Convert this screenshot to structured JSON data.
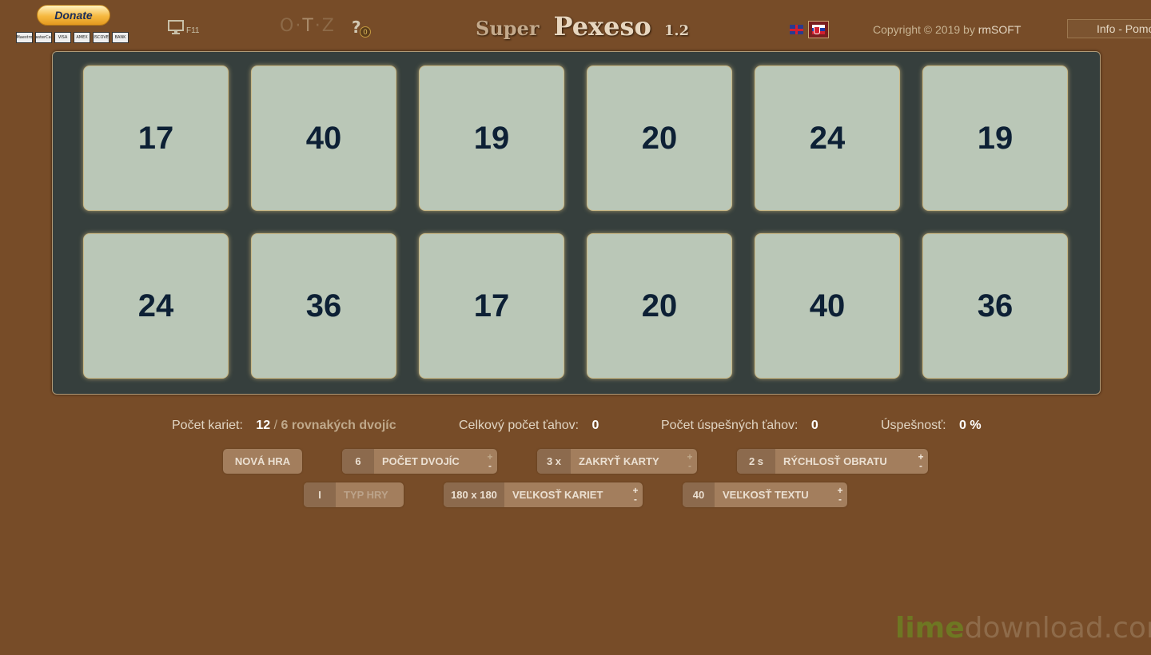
{
  "header": {
    "donate_label": "Donate",
    "payment_logos": [
      "Maestro",
      "MasterCard",
      "VISA",
      "AMEX",
      "DISCOVER",
      "BANK"
    ],
    "fullscreen_key": "F11",
    "otz": [
      "O",
      "T",
      "Z"
    ],
    "help_label": "?",
    "help_badge": "0",
    "title_super": "Super",
    "title_pexeso": "Pexeso",
    "version": "1.2",
    "copyright_prefix": "Copyright © 2019 by",
    "copyright_author": "rmSOFT",
    "info_label": "Info - Pomoc"
  },
  "board": {
    "tiles": [
      "17",
      "40",
      "19",
      "20",
      "24",
      "19",
      "24",
      "36",
      "17",
      "20",
      "40",
      "36"
    ],
    "colors": {
      "board_bg": "#363f3d",
      "tile_bg": "#bac7b7",
      "tile_text": "#0d2035"
    }
  },
  "stats": {
    "cards_label": "Počet kariet:",
    "cards_value": "12",
    "pairs_text": "6 rovnakých dvojíc",
    "total_moves_label": "Celkový počet ťahov:",
    "total_moves_value": "0",
    "success_moves_label": "Počet úspešných ťahov:",
    "success_moves_value": "0",
    "success_rate_label": "Úspešnosť:",
    "success_rate_value": "0 %"
  },
  "controls": {
    "new_game": "NOVÁ HRA",
    "pairs_value": "6",
    "pairs_label": "POČET DVOJÍC",
    "hide_value": "3 x",
    "hide_label": "ZAKRYŤ KARTY",
    "speed_value": "2 s",
    "speed_label": "RÝCHLOSŤ OBRATU",
    "type_value": "I",
    "type_label": "TYP HRY",
    "card_size_value": "180 x 180",
    "card_size_label": "VEĽKOSŤ KARIET",
    "text_size_value": "40",
    "text_size_label": "VEĽKOSŤ TEXTU",
    "plus": "+",
    "minus": "-"
  },
  "watermark": {
    "lime": "lime",
    "rest": "download.com"
  },
  "colors": {
    "background": "#774c28",
    "button": "#a37e5d"
  }
}
